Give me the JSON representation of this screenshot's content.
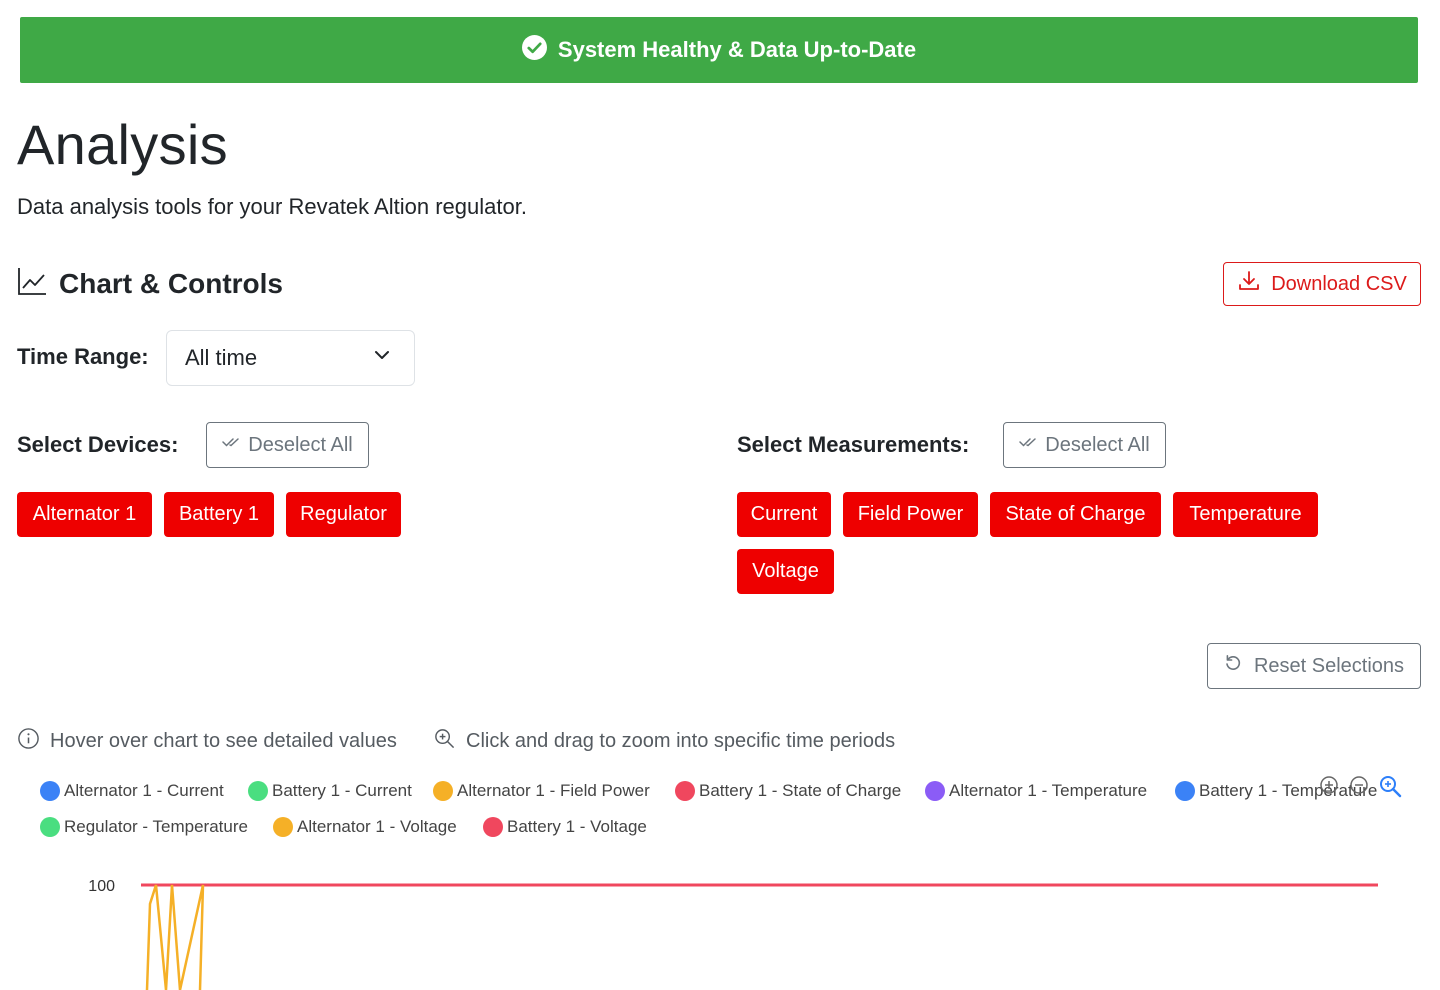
{
  "status": {
    "text": "System Healthy & Data Up-to-Date",
    "icon": "check-circle-icon",
    "color": "#3fa946"
  },
  "page": {
    "title": "Analysis",
    "subtitle": "Data analysis tools for your Revatek Altion regulator."
  },
  "section": {
    "title": "Chart & Controls",
    "icon": "line-chart-icon"
  },
  "download": {
    "label": "Download CSV",
    "icon": "download-icon"
  },
  "time_range": {
    "label": "Time Range:",
    "selected": "All time"
  },
  "devices": {
    "label": "Select Devices:",
    "deselect_label": "Deselect All",
    "items": [
      "Alternator 1",
      "Battery 1",
      "Regulator"
    ]
  },
  "measurements": {
    "label": "Select Measurements:",
    "deselect_label": "Deselect All",
    "items": [
      "Current",
      "Field Power",
      "State of Charge",
      "Temperature",
      "Voltage"
    ]
  },
  "reset": {
    "label": "Reset Selections"
  },
  "hints": {
    "hover": "Hover over chart to see detailed values",
    "zoom": "Click and drag to zoom into specific time periods"
  },
  "accent_color": "#ee0000",
  "legend": [
    {
      "label": "Alternator 1 - Current",
      "color": "#3b82f6"
    },
    {
      "label": "Battery 1 - Current",
      "color": "#4ade80"
    },
    {
      "label": "Alternator 1 - Field Power",
      "color": "#f5b027"
    },
    {
      "label": "Battery 1 - State of Charge",
      "color": "#f0475e"
    },
    {
      "label": "Alternator 1 - Temperature",
      "color": "#8b5cf6"
    },
    {
      "label": "Battery 1 - Temperature",
      "color": "#3b82f6"
    },
    {
      "label": "Regulator - Temperature",
      "color": "#4ade80"
    },
    {
      "label": "Alternator 1 - Voltage",
      "color": "#f5b027"
    },
    {
      "label": "Battery 1 - Voltage",
      "color": "#f0475e"
    }
  ],
  "chart_data": {
    "type": "line",
    "y_ticks": [
      "100"
    ],
    "series": [
      {
        "name": "Battery 1 - State of Charge",
        "color": "#f0475e",
        "values": [
          100,
          100,
          100,
          100,
          100,
          100,
          100,
          100,
          100,
          100,
          100,
          100
        ]
      },
      {
        "name": "Alternator 1 - Field Power",
        "color": "#f5b027",
        "values": [
          0,
          95,
          100,
          0,
          100,
          0,
          100
        ]
      }
    ]
  }
}
